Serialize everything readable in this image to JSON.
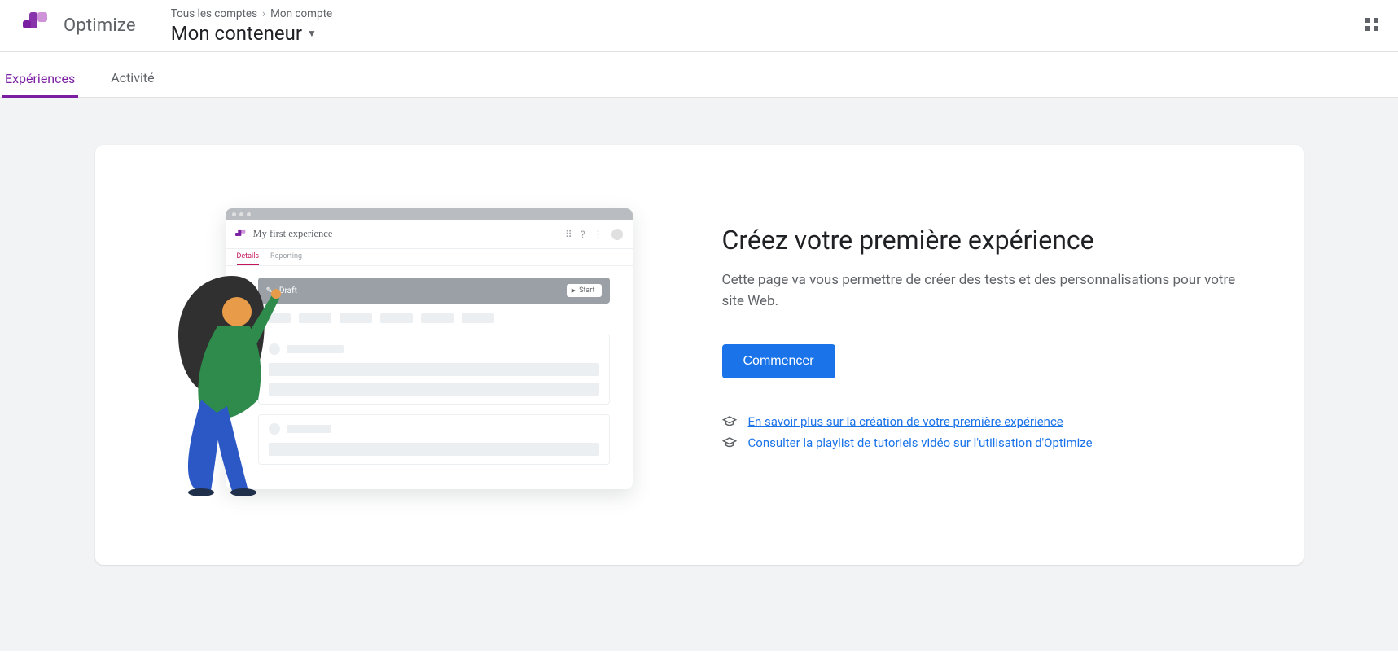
{
  "header": {
    "product": "Optimize",
    "breadcrumb": {
      "all": "Tous les comptes",
      "account": "Mon compte"
    },
    "container": "Mon conteneur"
  },
  "tabs": {
    "experiences": "Expériences",
    "activity": "Activité"
  },
  "main": {
    "heading": "Créez votre première expérience",
    "subhead": "Cette page va vous permettre de créer des tests et des personnalisations pour votre site Web.",
    "cta": "Commencer",
    "link1": " En savoir plus sur la création de votre première expérience",
    "link2": " Consulter la playlist de tutoriels vidéo sur l'utilisation d'Optimize"
  },
  "illus": {
    "window_title": "My first experience",
    "details_tab": "Details",
    "reporting_tab": "Reporting",
    "status": "Draft",
    "start": "Start"
  }
}
